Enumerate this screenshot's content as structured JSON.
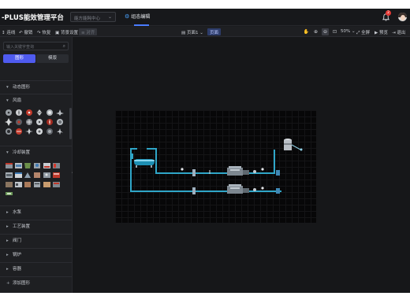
{
  "header": {
    "brand": "-PLUS能效管理平台",
    "project_select": {
      "placeholder": "能方能耗中心"
    },
    "active_tab": "组态编辑",
    "notification_count": "2"
  },
  "toolbar": {
    "items": [
      "连线",
      "撤销",
      "恢复",
      "背景设置"
    ],
    "disabled_item": "对齐",
    "page_select": "页面1",
    "page_button": "页面",
    "zoom": "50%",
    "fullscreen": "全屏",
    "preview": "预览",
    "exit": "退出"
  },
  "sidebar": {
    "search_placeholder": "输入关键字查询",
    "segments": [
      "图形",
      "模版"
    ],
    "sections": [
      {
        "label": "动态图形",
        "expanded": true
      },
      {
        "label": "风扇",
        "expanded": true
      },
      {
        "label": "冷却装置",
        "expanded": true
      },
      {
        "label": "水泵",
        "expanded": false
      },
      {
        "label": "工艺装置",
        "expanded": false
      },
      {
        "label": "阀门",
        "expanded": false
      },
      {
        "label": "锅炉",
        "expanded": false
      },
      {
        "label": "容器",
        "expanded": false
      },
      {
        "label": "添加图形",
        "expanded": false
      }
    ]
  },
  "colors": {
    "accent": "#4f5bf0",
    "pipe": "#2fa6c8",
    "badge": "#e53935",
    "fan_red": "#c0392b"
  },
  "icons": [
    "bell-icon",
    "avatar",
    "search-icon",
    "chevron-down-icon",
    "fullscreen-icon",
    "preview-icon",
    "exit-icon"
  ]
}
